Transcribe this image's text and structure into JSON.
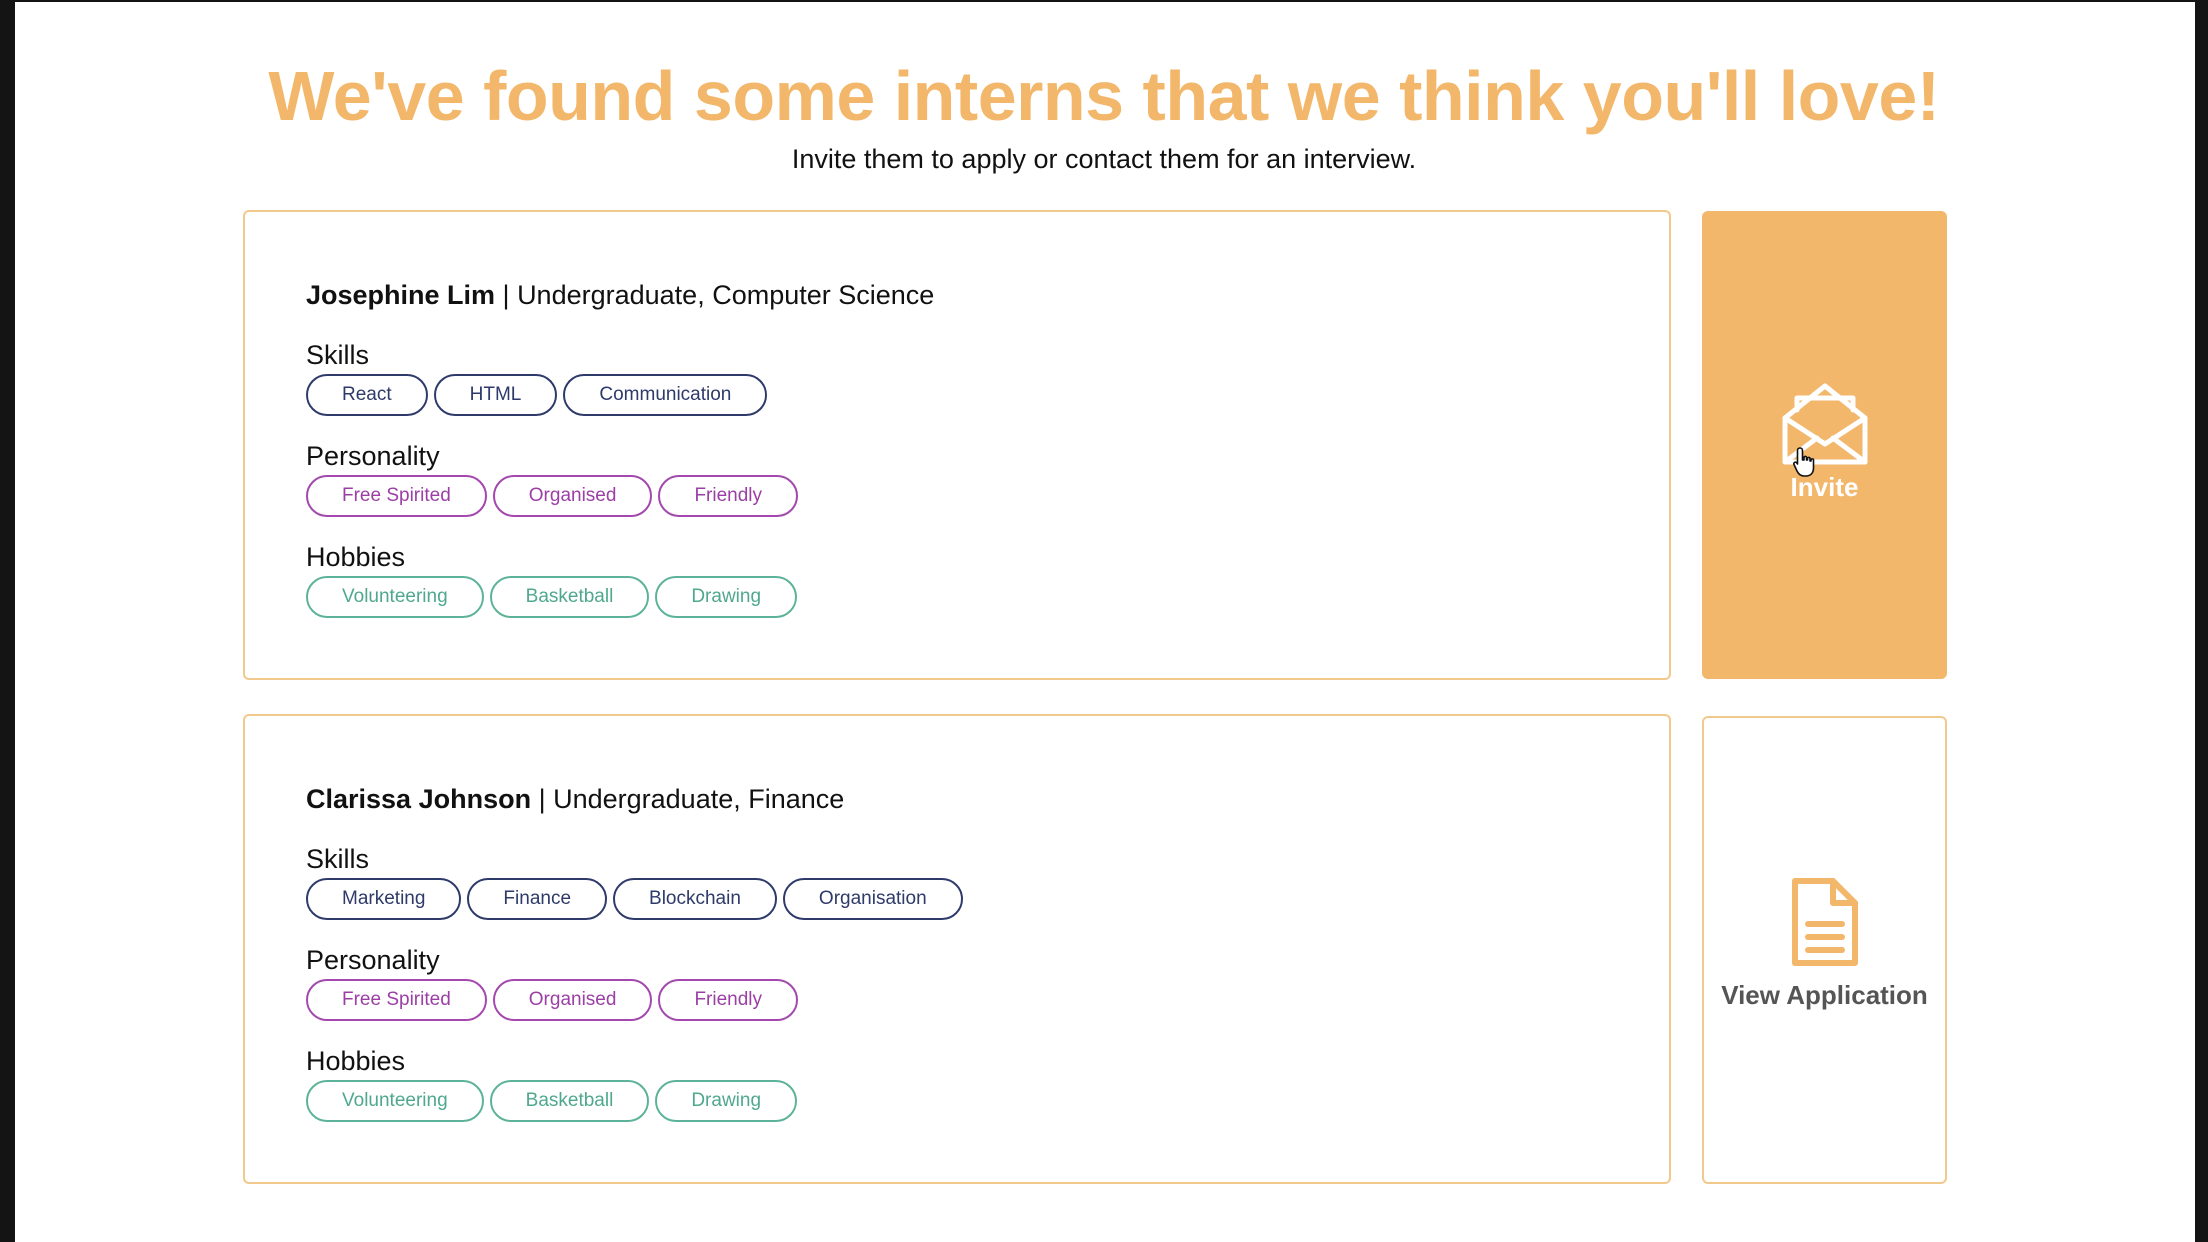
{
  "header": {
    "title": "We've found some interns that we think you'll love!",
    "subtitle": "Invite them to apply or contact them for an interview."
  },
  "section_labels": {
    "skills": "Skills",
    "personality": "Personality",
    "hobbies": "Hobbies"
  },
  "interns": [
    {
      "name": "Josephine Lim",
      "details": " | Undergraduate, Computer Science",
      "skills": [
        "React",
        "HTML",
        "Communication"
      ],
      "personality": [
        "Free Spirited",
        "Organised",
        "Friendly"
      ],
      "hobbies": [
        "Volunteering",
        "Basketball",
        "Drawing"
      ],
      "action": {
        "label": "Invite",
        "icon": "envelope-open-icon"
      }
    },
    {
      "name": "Clarissa Johnson",
      "details": " | Undergraduate, Finance",
      "skills": [
        "Marketing",
        "Finance",
        "Blockchain",
        "Organisation"
      ],
      "personality": [
        "Free Spirited",
        "Organised",
        "Friendly"
      ],
      "hobbies": [
        "Volunteering",
        "Basketball",
        "Drawing"
      ],
      "action": {
        "label": "View Application",
        "icon": "document-icon"
      }
    }
  ],
  "colors": {
    "accent": "#F2B76A",
    "skill_tag": "#2E3A6A",
    "personality_tag": "#9B3FA5",
    "hobby_tag": "#4FA88E"
  }
}
